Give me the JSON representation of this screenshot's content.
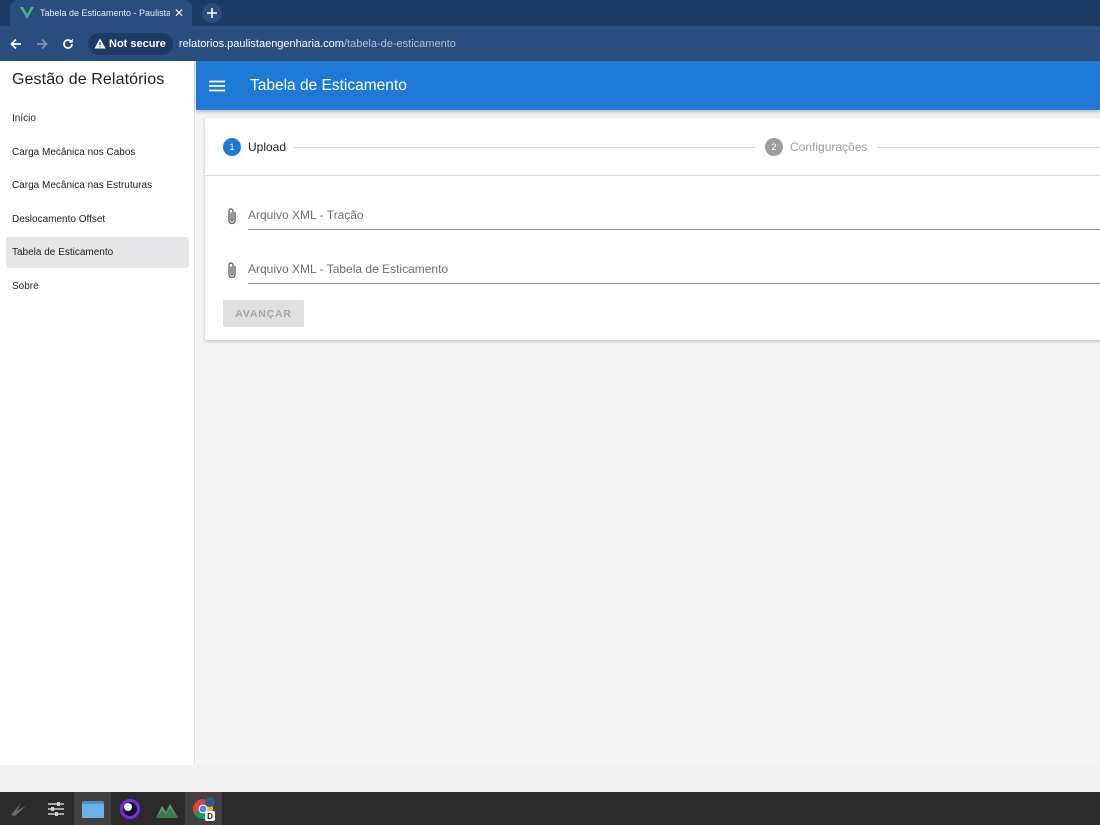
{
  "browser": {
    "tab_title": "Tabela de Esticamento - Paulista En",
    "security_label": "Not secure",
    "url_domain": "relatorios.paulistaengenharia.com",
    "url_path": "/tabela-de-esticamento"
  },
  "sidebar": {
    "title": "Gestão de Relatórios",
    "items": [
      {
        "label": "Início",
        "active": false
      },
      {
        "label": "Carga Mecânica nos Cabos",
        "active": false
      },
      {
        "label": "Carga Mecânica nas Estruturas",
        "active": false
      },
      {
        "label": "Deslocamento Offset",
        "active": false
      },
      {
        "label": "Tabela de Esticamento",
        "active": true
      },
      {
        "label": "Sobre",
        "active": false
      }
    ]
  },
  "appbar": {
    "title": "Tabela de Esticamento"
  },
  "stepper": {
    "steps": [
      {
        "number": "1",
        "label": "Upload",
        "active": true
      },
      {
        "number": "2",
        "label": "Configurações",
        "active": false
      }
    ]
  },
  "form": {
    "fields": [
      {
        "placeholder": "Arquivo XML - Tração",
        "value": ""
      },
      {
        "placeholder": "Arquivo XML - Tabela de Esticamento",
        "value": ""
      }
    ],
    "advance_label": "AVANÇAR"
  },
  "colors": {
    "primary": "#1e7ad6",
    "browser_dark": "#1c3a66",
    "browser_toolbar": "#2a4d80",
    "taskbar": "#2a2a2a"
  },
  "taskbar": {
    "items": [
      "launcher-icon",
      "settings-icon",
      "files-icon",
      "circle-app-icon",
      "image-viewer-icon",
      "chrome-icon"
    ]
  }
}
